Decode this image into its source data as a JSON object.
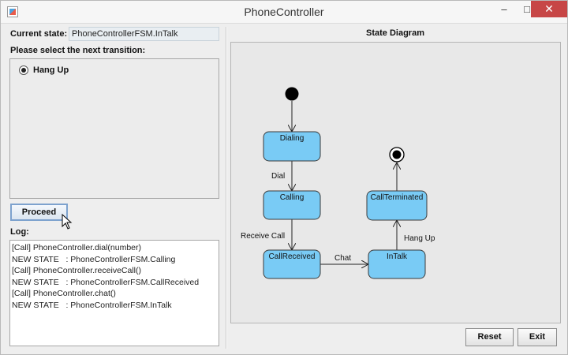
{
  "window": {
    "title": "PhoneController",
    "controls": {
      "minimize": "–",
      "maximize": "□",
      "close": "✕"
    }
  },
  "current_state": {
    "label": "Current state:",
    "value": "PhoneControllerFSM.InTalk"
  },
  "transitions": {
    "label": "Please select the next transition:",
    "options": [
      {
        "label": "Hang Up",
        "selected": true
      }
    ]
  },
  "proceed_label": "Proceed",
  "log": {
    "label": "Log:",
    "lines": [
      "[Call] PhoneController.dial(number)",
      "NEW STATE   : PhoneControllerFSM.Calling",
      "[Call] PhoneController.receiveCall()",
      "NEW STATE   : PhoneControllerFSM.CallReceived",
      "[Call] PhoneController.chat()",
      "NEW STATE   : PhoneControllerFSM.InTalk"
    ]
  },
  "diagram": {
    "title": "State Diagram",
    "states": [
      "Dialing",
      "Calling",
      "CallReceived",
      "InTalk",
      "CallTerminated"
    ],
    "transitions": [
      {
        "label": "Dial"
      },
      {
        "label": "Receive Call"
      },
      {
        "label": "Chat"
      },
      {
        "label": "Hang Up"
      }
    ],
    "state_fill_color": "#79cbf5"
  },
  "buttons": {
    "reset": "Reset",
    "exit": "Exit"
  }
}
